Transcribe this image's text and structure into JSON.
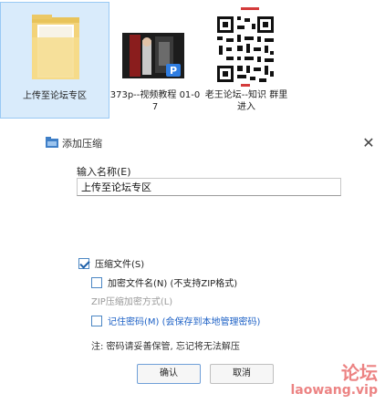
{
  "explorer": {
    "files": [
      {
        "name": "上传至论坛专区",
        "kind": "folder",
        "selected": true
      },
      {
        "name": "373p--视频教程 01-07",
        "kind": "video",
        "selected": false
      },
      {
        "name": "老王论坛--知识 群里进入",
        "kind": "image",
        "selected": false
      }
    ],
    "video_badge": "P"
  },
  "dialog": {
    "title": "添加压缩",
    "name_label": "输入名称(E)",
    "name_value": "上传至论坛专区",
    "close_symbol": "✕",
    "options": {
      "zip_label": "压缩文件(S)",
      "zip_checked": true,
      "split_label": "加密文件名(N) (不支持ZIP格式)",
      "split_checked": false,
      "method_label": "ZIP压缩加密方式(L)",
      "method_checked": false,
      "remember_label": "记住密码(M) (会保存到本地管理密码)",
      "remember_checked": false
    },
    "note": "注: 密码请妥善保管, 忘记将无法解压",
    "ok_label": "确认",
    "cancel_label": "取消"
  },
  "watermark": {
    "line1": "论坛",
    "line2": "laowang.vip"
  }
}
